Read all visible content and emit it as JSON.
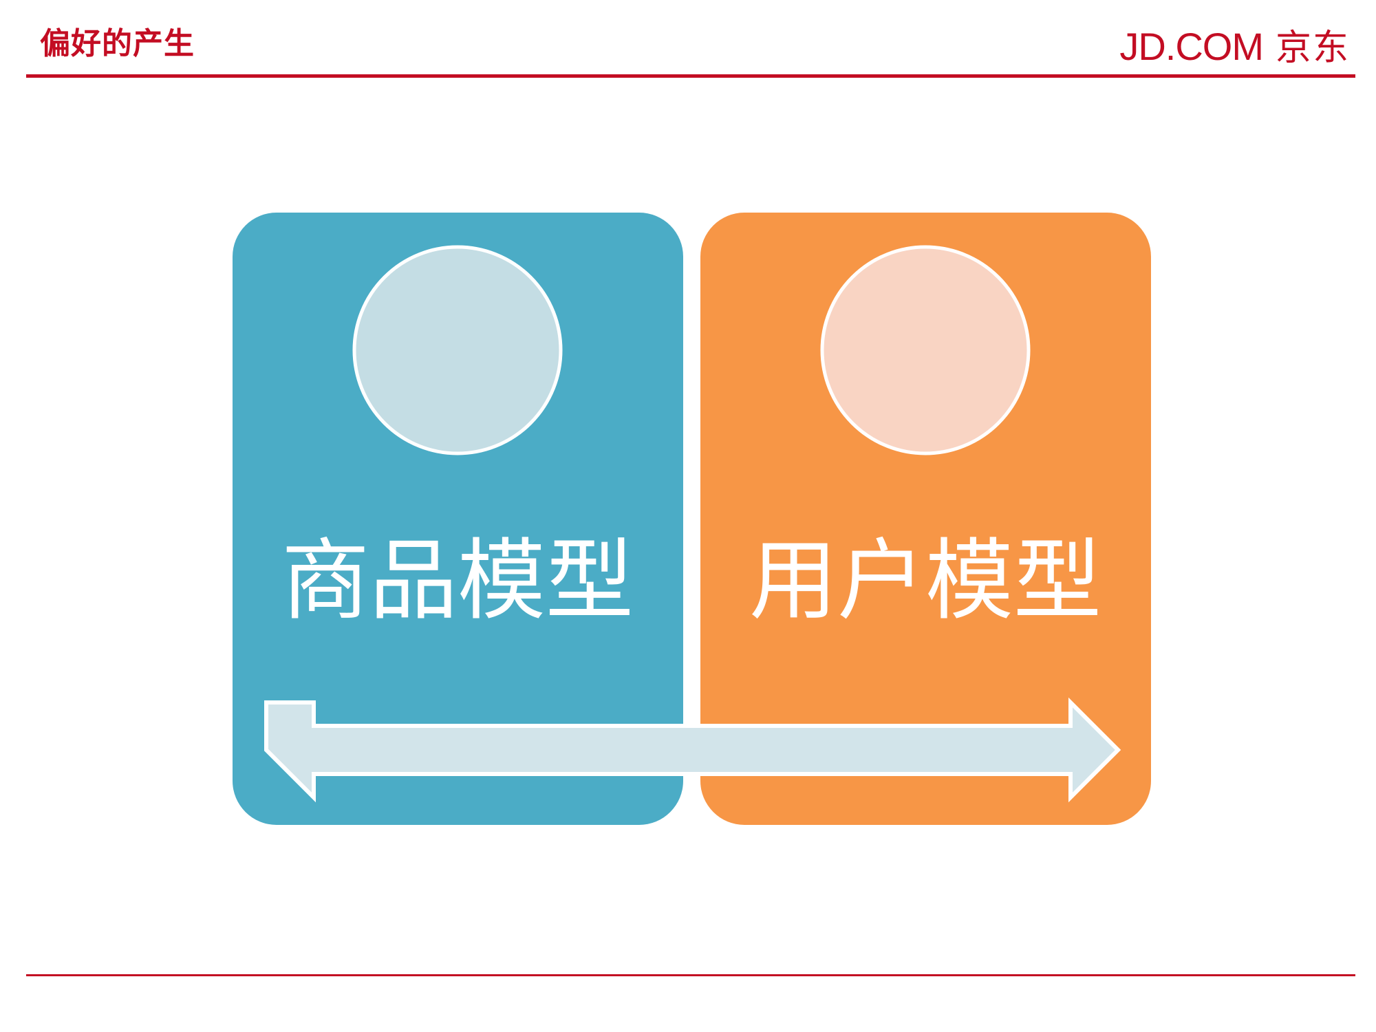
{
  "header": {
    "title": "偏好的产生",
    "logo_latin": "JD.COM",
    "logo_cn": "京东"
  },
  "diagram": {
    "cards": [
      {
        "label": "商品模型",
        "color": "#4bacc6",
        "circle_color": "#c4dde4"
      },
      {
        "label": "用户模型",
        "color": "#f79646",
        "circle_color": "#f9d4c3"
      }
    ],
    "arrow": {
      "type": "double-headed",
      "color": "#d2e4ea",
      "outline": "#ffffff"
    }
  },
  "colors": {
    "brand": "#c30d23"
  }
}
